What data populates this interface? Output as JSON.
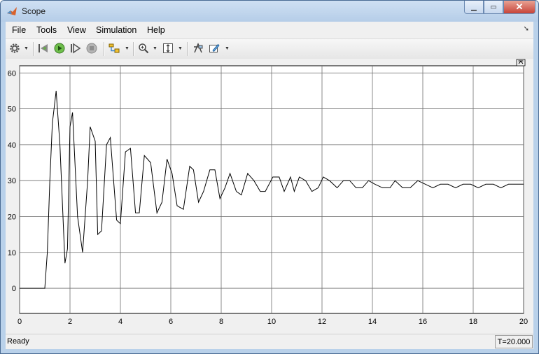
{
  "window": {
    "title": "Scope"
  },
  "menu": {
    "items": [
      "File",
      "Tools",
      "View",
      "Simulation",
      "Help"
    ]
  },
  "toolbar": {
    "icons": [
      "gear-icon",
      "step-back-icon",
      "run-icon",
      "step-forward-icon",
      "stop-icon",
      "highlight-icon",
      "zoom-icon",
      "autoscale-icon",
      "signal-selector-icon",
      "edit-icon"
    ]
  },
  "status": {
    "left": "Ready",
    "time": "T=20.000"
  },
  "chart_data": {
    "type": "line",
    "title": "",
    "xlabel": "",
    "ylabel": "",
    "xlim": [
      0,
      20
    ],
    "ylim": [
      -7,
      62
    ],
    "xticks": [
      0,
      2,
      4,
      6,
      8,
      10,
      12,
      14,
      16,
      18,
      20
    ],
    "yticks": [
      0,
      10,
      20,
      30,
      40,
      50,
      60
    ],
    "grid": true,
    "series": [
      {
        "color": "#000000",
        "x": [
          0,
          1.0,
          1.1,
          1.2,
          1.3,
          1.45,
          1.6,
          1.8,
          1.9,
          2.0,
          2.1,
          2.3,
          2.5,
          2.7,
          2.8,
          3.0,
          3.1,
          3.25,
          3.45,
          3.6,
          3.85,
          4.0,
          4.2,
          4.4,
          4.6,
          4.75,
          4.95,
          5.2,
          5.45,
          5.65,
          5.85,
          6.05,
          6.25,
          6.5,
          6.75,
          6.9,
          7.1,
          7.3,
          7.55,
          7.75,
          7.95,
          8.15,
          8.35,
          8.6,
          8.8,
          9.05,
          9.3,
          9.55,
          9.75,
          10.05,
          10.3,
          10.5,
          10.75,
          10.9,
          11.1,
          11.35,
          11.6,
          11.85,
          12.05,
          12.3,
          12.6,
          12.85,
          13.1,
          13.35,
          13.6,
          13.85,
          14.1,
          14.4,
          14.7,
          14.9,
          15.2,
          15.5,
          15.8,
          16.1,
          16.4,
          16.7,
          17.0,
          17.3,
          17.6,
          17.9,
          18.2,
          18.5,
          18.8,
          19.1,
          19.4,
          19.7,
          20.0
        ],
        "y": [
          0,
          0,
          10,
          30,
          46,
          55,
          40,
          7,
          11,
          45,
          49,
          20,
          10,
          30,
          45,
          41,
          15,
          16,
          40,
          42,
          19,
          18,
          38,
          39,
          21,
          21,
          37,
          35,
          21,
          24,
          36,
          32,
          23,
          22,
          34,
          33,
          24,
          27,
          33,
          33,
          25,
          28,
          32,
          27,
          26,
          32,
          30,
          27,
          27,
          31,
          31,
          27,
          31,
          27,
          31,
          30,
          27,
          28,
          31,
          30,
          28,
          30,
          30,
          28,
          28,
          30,
          29,
          28,
          28,
          30,
          28,
          28,
          30,
          29,
          28,
          29,
          29,
          28,
          29,
          29,
          28,
          29,
          29,
          28,
          29,
          29,
          29
        ]
      }
    ]
  }
}
